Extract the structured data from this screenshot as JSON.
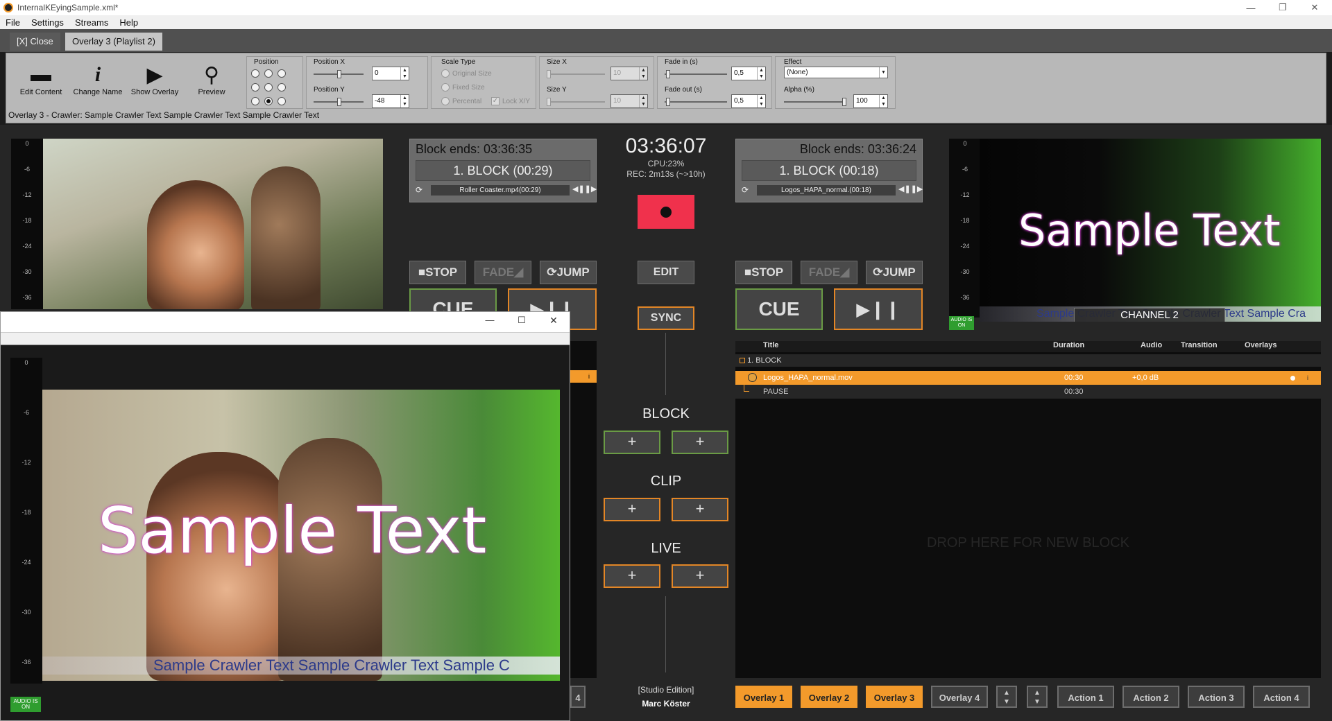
{
  "window": {
    "title": "InternalKEyingSample.xml*"
  },
  "menu": [
    "File",
    "Settings",
    "Streams",
    "Help"
  ],
  "tabs": {
    "close": "[X] Close",
    "active": "Overlay 3 (Playlist 2)"
  },
  "ribbon": {
    "buttons": {
      "edit_content": "Edit Content",
      "change_name": "Change Name",
      "show_overlay": "Show Overlay",
      "preview": "Preview"
    },
    "position_label": "Position",
    "position_selected": "bottom-center",
    "position_x": {
      "label": "Position X",
      "value": "0"
    },
    "position_y": {
      "label": "Position Y",
      "value": "-48"
    },
    "scale_type": {
      "label": "Scale Type",
      "options": [
        "Original Size",
        "Fixed Size",
        "Percental"
      ],
      "lock": "Lock X/Y"
    },
    "size_x": {
      "label": "Size X",
      "value": "10"
    },
    "size_y": {
      "label": "Size Y",
      "value": "10"
    },
    "fade_in": {
      "label": "Fade in (s)",
      "value": "0,5"
    },
    "fade_out": {
      "label": "Fade out (s)",
      "value": "0,5"
    },
    "effect": {
      "label": "Effect",
      "value": "(None)"
    },
    "alpha": {
      "label": "Alpha (%)",
      "value": "100"
    },
    "status": "Overlay 3 -  Crawler: Sample Crawler Text Sample Crawler Text Sample Crawler Text"
  },
  "meter_ticks": [
    "0",
    "-6",
    "-12",
    "-18",
    "-24",
    "-30",
    "-36"
  ],
  "left_channel": {
    "block_ends": "Block ends: 03:36:35",
    "block": "1. BLOCK (00:29)",
    "clip": "Roller Coaster.mp4(00:29)",
    "stop": "STOP",
    "fade": "FADE",
    "jump": "JUMP",
    "cue": "CUE",
    "play_pause": "▶❙❙"
  },
  "right_channel": {
    "block_ends": "Block ends: 03:36:24",
    "block": "1. BLOCK (00:18)",
    "clip": "Logos_HAPA_normal.(00:18)",
    "stop": "STOP",
    "fade": "FADE",
    "jump": "JUMP",
    "cue": "CUE",
    "play_pause": "▶❙❙",
    "channel_label": "CHANNEL 2",
    "audio_badge": "AUDIO IS ON"
  },
  "center": {
    "clock": "03:36:07",
    "cpu": "CPU:23%",
    "rec": "REC: 2m13s (~>10h)",
    "edit": "EDIT",
    "sync": "SYNC",
    "block_label": "BLOCK",
    "clip_label": "CLIP",
    "live_label": "LIVE",
    "plus": "+",
    "edition": "[Studio Edition]",
    "user": "Marc Köster"
  },
  "playlist": {
    "headers": {
      "title": "Title",
      "duration": "Duration",
      "audio": "Audio",
      "transition": "Transition",
      "overlays": "Overlays"
    },
    "block_name": "1. BLOCK",
    "rows": [
      {
        "title": "Logos_HAPA_normal.mov",
        "duration": "00:30",
        "audio": "+0,0 dB",
        "info": "i"
      },
      {
        "title": "PAUSE",
        "duration": "00:30",
        "audio": "",
        "info": ""
      }
    ],
    "drop_hint": "DROP HERE FOR NEW BLOCK"
  },
  "overlay_buttons": [
    "Overlay 1",
    "Overlay 2",
    "Overlay 3",
    "Overlay 4"
  ],
  "action_buttons": [
    "Action 1",
    "Action 2",
    "Action 3",
    "Action 4"
  ],
  "preview_window": {
    "sample_text": "Sample Text",
    "crawler": "Sample Crawler Text Sample Crawler Text Sample C",
    "audio_badge": "AUDIO IS ON",
    "left_partial_label": "4",
    "left_row_info": "i"
  },
  "right_preview": {
    "sample_text": "Sample Text",
    "crawler": "Sample Crawler Text Sample Crawler Text Sample Cra"
  },
  "colors": {
    "accent": "#f39a2b",
    "record": "#f0314c",
    "green": "#6a9b45"
  }
}
